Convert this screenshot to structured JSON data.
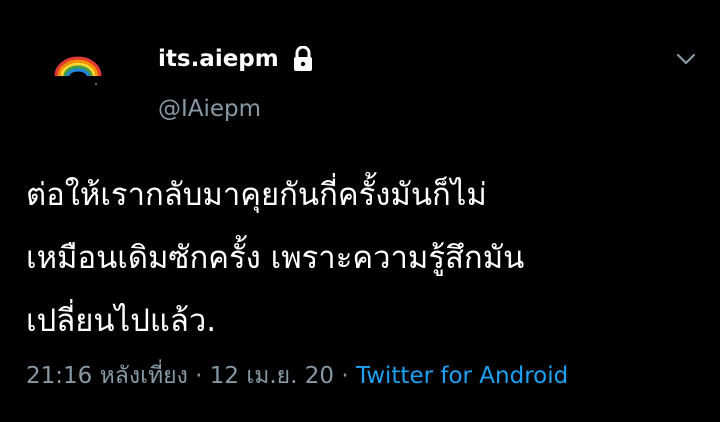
{
  "user": {
    "display_name": "its.aiepm",
    "handle": "@IAiepm",
    "avatar_icon": "rainbow-icon",
    "protected_icon": "lock-icon"
  },
  "menu": {
    "icon": "chevron-down-icon"
  },
  "tweet": {
    "text": "ต่อให้เรากลับมาคุยกันกี่ครั้งมันก็ไม่\nเหมือนเดิมซักครั้ง เพราะความรู้สึกมัน\nเปลี่ยนไปแล้ว.",
    "time": "21:16 หลังเที่ยง",
    "separator": "·",
    "date": "12 เม.ย. 20",
    "source": "Twitter for Android"
  },
  "colors": {
    "background": "#000000",
    "text": "#ffffff",
    "secondary": "#8899a6",
    "link": "#1da1f2"
  }
}
